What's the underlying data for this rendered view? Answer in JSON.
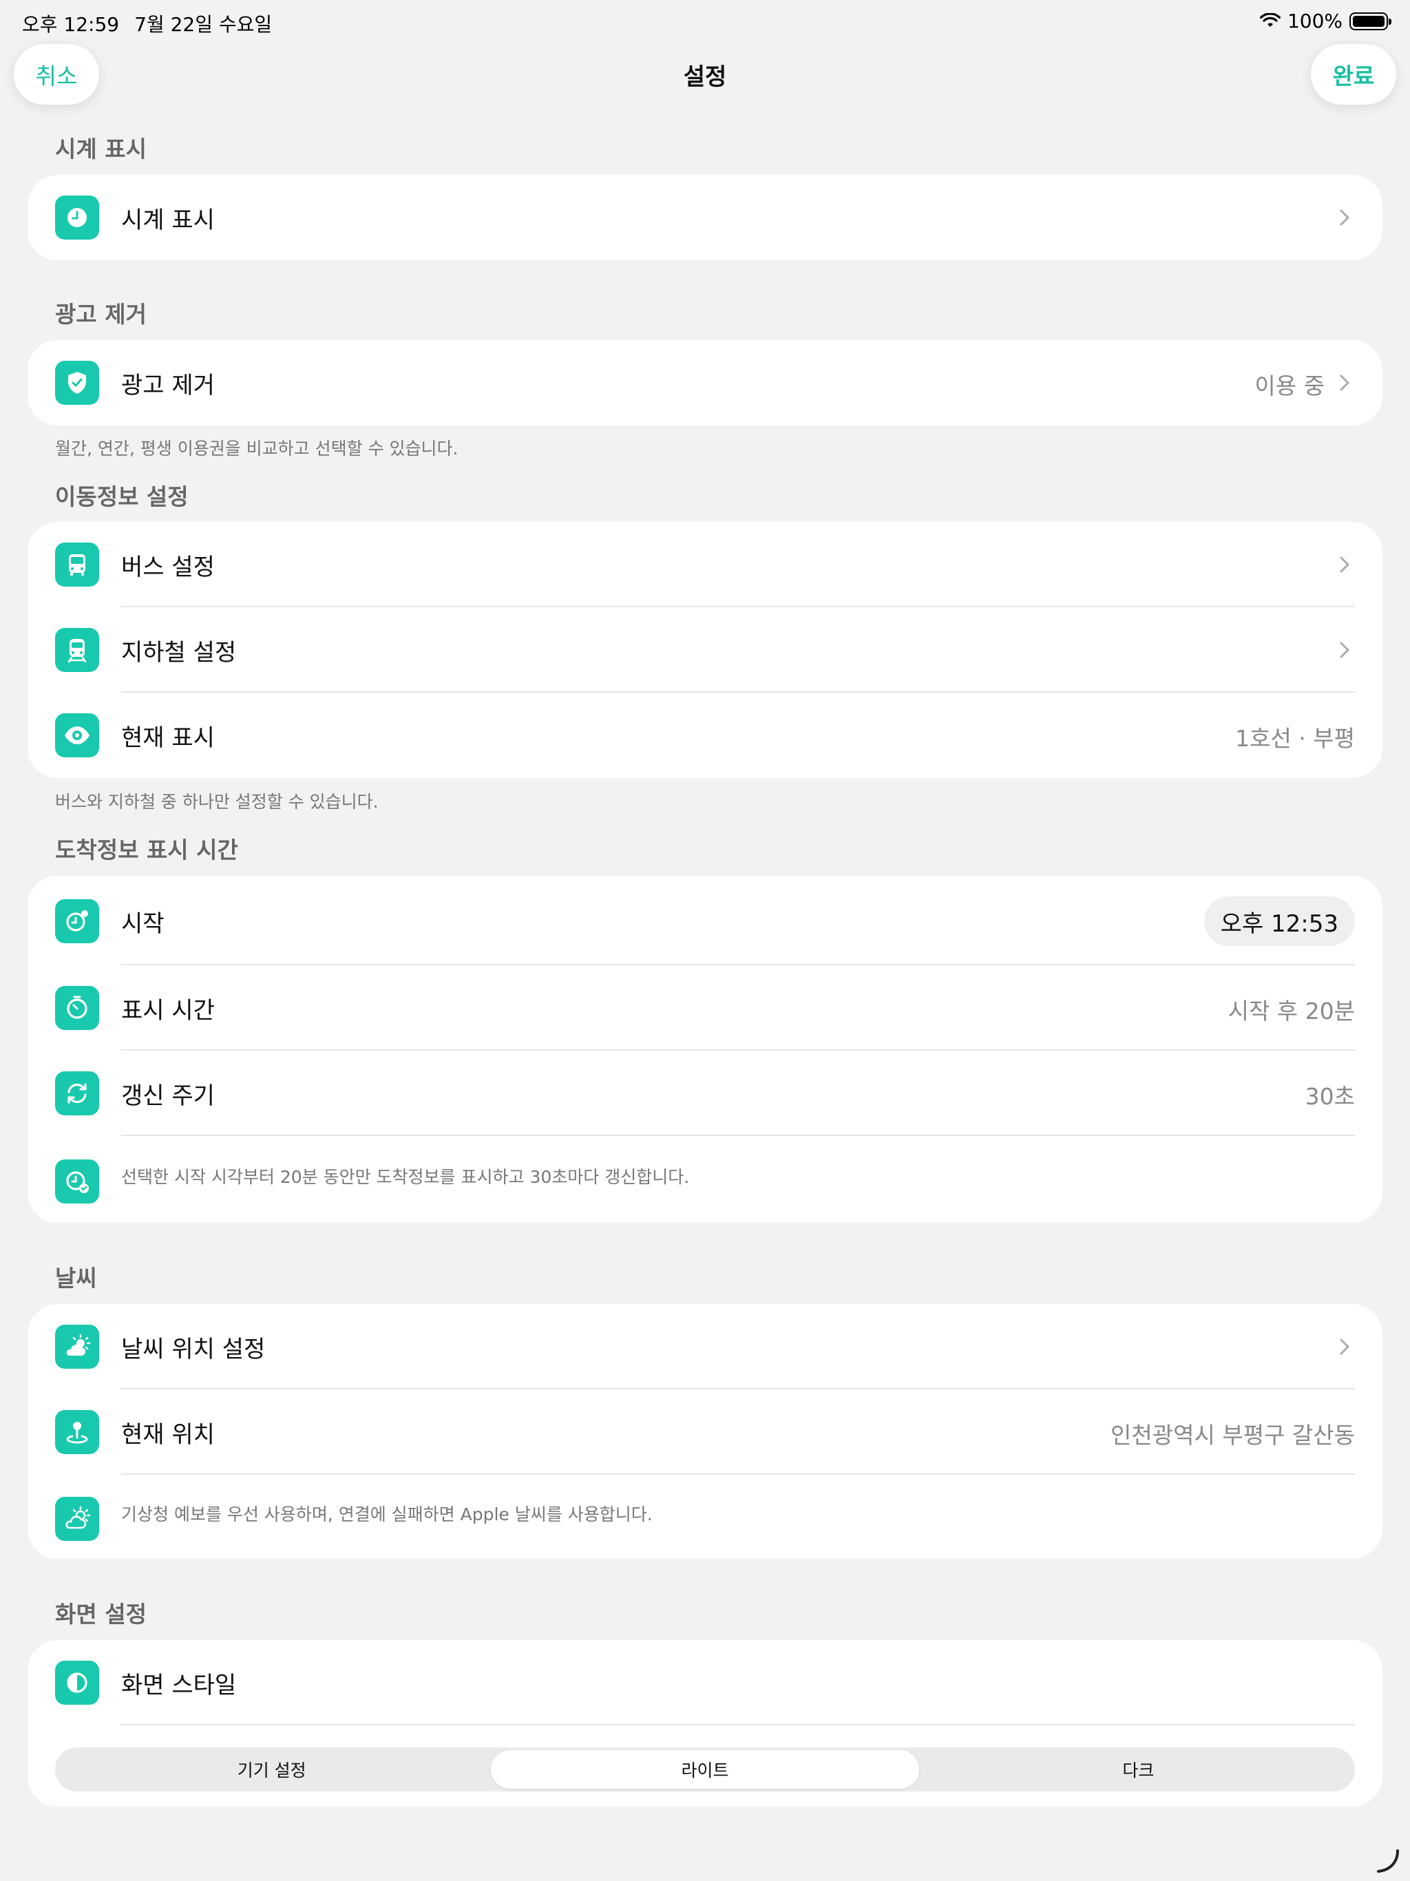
{
  "status_bar": {
    "time": "오후 12:59",
    "date": "7월 22일 수요일",
    "battery": "100%"
  },
  "nav": {
    "cancel": "취소",
    "title": "설정",
    "done": "완료"
  },
  "sections": {
    "clock": {
      "header": "시계 표시",
      "row_label": "시계 표시"
    },
    "ads": {
      "header": "광고 제거",
      "row_label": "광고 제거",
      "row_value": "이용 중",
      "footer": "월간, 연간, 평생 이용권을 비교하고 선택할 수 있습니다."
    },
    "transit": {
      "header": "이동정보 설정",
      "bus_label": "버스 설정",
      "subway_label": "지하철 설정",
      "current_label": "현재 표시",
      "current_value": "1호선 · 부평",
      "footer": "버스와 지하철 중 하나만 설정할 수 있습니다."
    },
    "arrival": {
      "header": "도착정보 표시 시간",
      "start_label": "시작",
      "start_value": "오후 12:53",
      "duration_label": "표시 시간",
      "duration_value": "시작 후 20분",
      "refresh_label": "갱신 주기",
      "refresh_value": "30초",
      "description": "선택한 시작 시각부터 20분 동안만 도착정보를 표시하고 30초마다 갱신합니다."
    },
    "weather": {
      "header": "날씨",
      "location_setting_label": "날씨 위치 설정",
      "current_location_label": "현재 위치",
      "current_location_value": "인천광역시 부평구 갈산동",
      "description": "기상청 예보를 우선 사용하며, 연결에 실패하면 Apple 날씨를 사용합니다."
    },
    "display": {
      "header": "화면 설정",
      "style_label": "화면 스타일",
      "options": [
        "기기 설정",
        "라이트",
        "다크"
      ],
      "selected": "라이트"
    }
  },
  "colors": {
    "accent": "#18c9ad",
    "background": "#f2f2f2",
    "card": "#ffffff"
  }
}
